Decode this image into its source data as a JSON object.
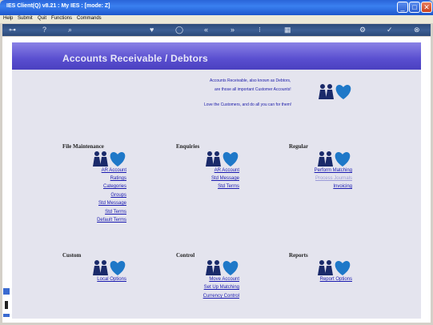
{
  "window": {
    "title": "IES Client(Q) v8.21 : My IES :      [mode: Z]",
    "minimize": "_",
    "maximize": "□",
    "close": "✕"
  },
  "menu": [
    "Help",
    "Submit",
    "Quit",
    "Functions",
    "Commands"
  ],
  "toolbar": {
    "icons": [
      "key-icon",
      "help-icon",
      "search-icon",
      "heart-icon",
      "circle-icon",
      "rewind-icon",
      "forward-icon",
      "info-icon",
      "print-icon",
      "settings-icon",
      "check-icon",
      "close-icon"
    ],
    "glyphs": [
      "⊶",
      "?",
      "⌕",
      "♥",
      "◯",
      "«",
      "»",
      "⁝",
      "▦",
      "⚙",
      "✓",
      "⊗"
    ]
  },
  "banner": {
    "title": "Accounts Receivable / Debtors"
  },
  "intro": {
    "line1": "Accounts Receivable, also known as Debtors,",
    "line2": "are those  all important Customer Accounts!",
    "line3": "Love the Customers, and do all you can for them!"
  },
  "sections": {
    "file_maintenance": {
      "title": "File Maintenance",
      "links": [
        "AR Account",
        "Ratings",
        "Categories",
        "Groups",
        "Std Message",
        "Std Terms",
        "Default Terms"
      ]
    },
    "enquiries": {
      "title": "Enquiries",
      "links": [
        "AR Account",
        "Std Message",
        "Std Terms"
      ]
    },
    "regular": {
      "title": "Regular",
      "links": [
        "Perform Matching",
        "Process Journals",
        "Invoicing"
      ]
    },
    "custom": {
      "title": "Custom",
      "links": [
        "Local Options"
      ]
    },
    "control": {
      "title": "Control",
      "links": [
        "Move Account",
        "Set Up Matching",
        "Currency Control"
      ]
    },
    "reports": {
      "title": "Reports",
      "links": [
        "Report Options"
      ]
    }
  },
  "colors": {
    "title_bar": "#2a64d8",
    "banner": "#5a4fd0",
    "page_bg": "#e4e4ee",
    "link": "#1a1ab0",
    "link_disabled": "#9a9ad8",
    "logo_people": "#1a2a6a",
    "logo_heart": "#1e78c8"
  }
}
